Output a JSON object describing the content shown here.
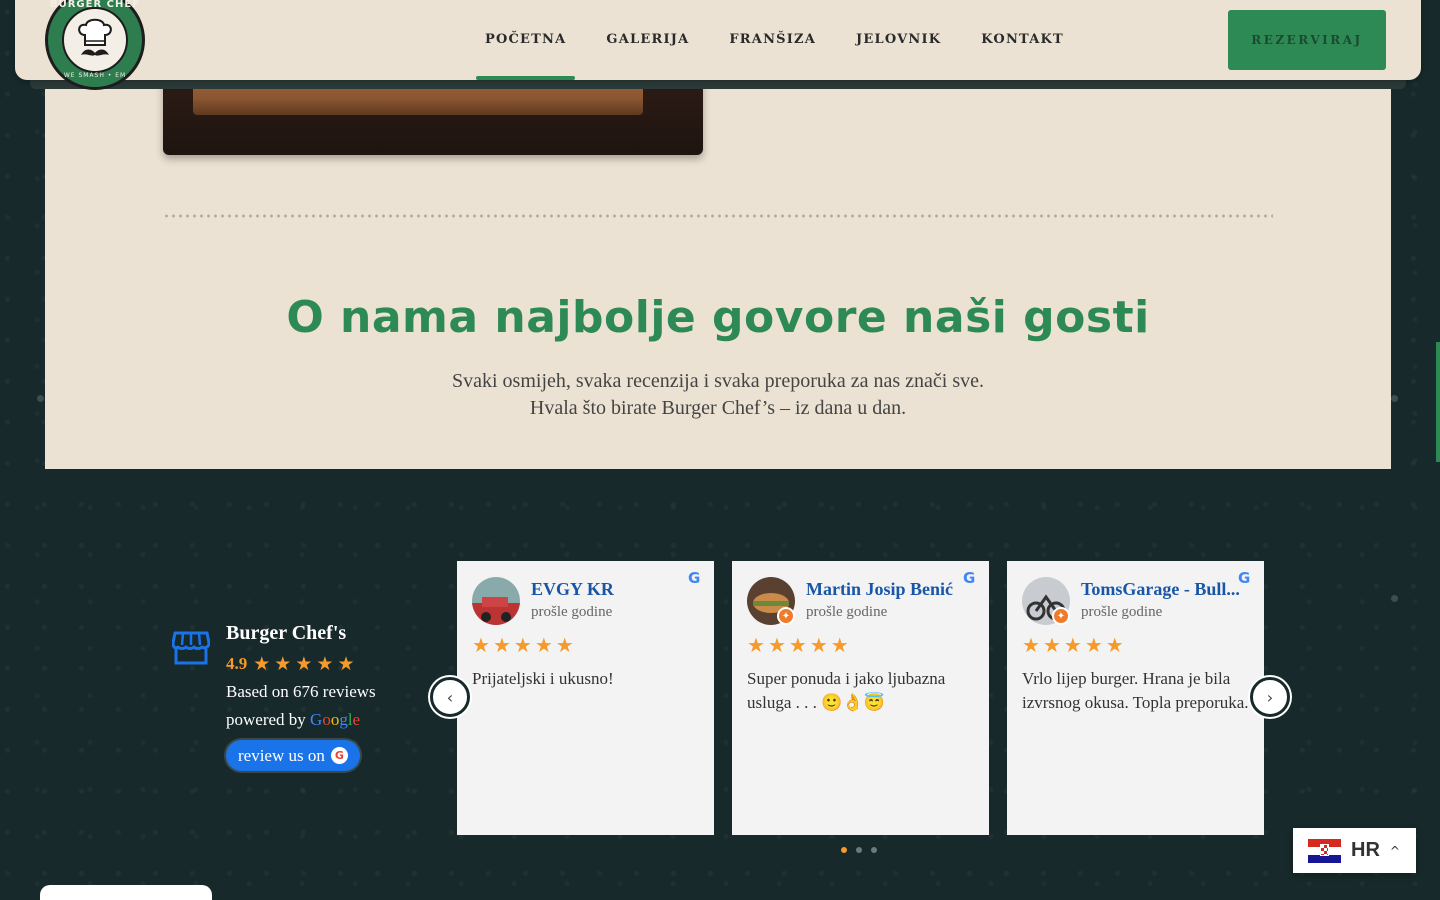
{
  "header": {
    "logo": {
      "text_top": "BURGER CHEF",
      "text_bottom": "WE SMASH • EM"
    },
    "nav": [
      {
        "label": "POČETNA",
        "active": true
      },
      {
        "label": "GALERIJA",
        "active": false
      },
      {
        "label": "FRANŠIZA",
        "active": false
      },
      {
        "label": "JELOVNIK",
        "active": false
      },
      {
        "label": "KONTAKT",
        "active": false
      }
    ],
    "reserve_label": "REZERVIRAJ"
  },
  "section": {
    "title": "O nama najbolje govore naši gosti",
    "subtitle_line1": "Svaki osmijeh, svaka recenzija i svaka preporuka za nas znači sve.",
    "subtitle_line2": "Hvala što birate Burger Chef’s – iz dana u dan."
  },
  "summary": {
    "name": "Burger Chef's",
    "rating": "4.9",
    "stars": 5,
    "based_on": "Based on 676 reviews",
    "powered_by": "powered by",
    "google_word": "Google",
    "review_button": "review us on"
  },
  "reviews": [
    {
      "name": "EVGY KR",
      "when": "prošle godine",
      "stars": 5,
      "text": "Prijateljski i ukusno!",
      "avatar_color": "#a33"
    },
    {
      "name": "Martin Josip Benić",
      "when": "prošle godine",
      "stars": 5,
      "text": "Super ponuda i jako ljubazna usluga . . .  🙂👌😇",
      "avatar_color": "#7a5a3a"
    },
    {
      "name": "TomsGarage - Bull...",
      "when": "prošle godine",
      "stars": 5,
      "text": "Vrlo lijep burger. Hrana je bila izvrsnog okusa. Topla preporuka.",
      "avatar_color": "#5a6a7a"
    }
  ],
  "carousel": {
    "prev_icon": "‹",
    "next_icon": "›",
    "pages": 3,
    "active_page": 0
  },
  "language": {
    "code": "HR"
  },
  "colors": {
    "accent": "#2e8a55",
    "star": "#f59a2b",
    "beige": "#ece2d3",
    "link": "#1a56a8"
  }
}
